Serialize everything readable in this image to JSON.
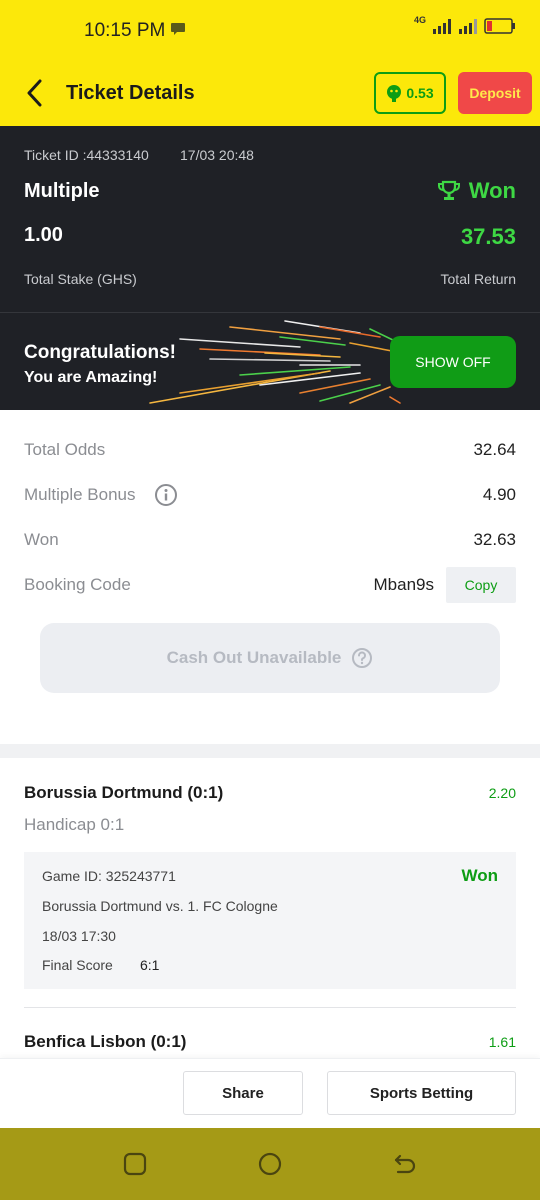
{
  "status_bar": {
    "time": "10:15 PM",
    "network": "4G"
  },
  "header": {
    "title": "Ticket Details",
    "balance": "0.53",
    "deposit_label": "Deposit"
  },
  "summary": {
    "ticket_id": "Ticket ID :44333140",
    "date": "17/03 20:48",
    "bet_type": "Multiple",
    "status": "Won",
    "total_stake": "1.00",
    "total_stake_label": "Total Stake (GHS)",
    "total_return": "37.53",
    "total_return_label": "Total Return"
  },
  "congrats": {
    "line1": "Congratulations!",
    "line2": "You are Amazing!",
    "button": "SHOW OFF"
  },
  "details": {
    "total_odds_label": "Total Odds",
    "total_odds": "32.64",
    "bonus_label": "Multiple Bonus",
    "bonus": "4.90",
    "won_label": "Won",
    "won": "32.63",
    "booking_label": "Booking Code",
    "booking_code": "Mban9s",
    "copy_label": "Copy",
    "cashout_label": "Cash Out Unavailable"
  },
  "selections": [
    {
      "team": "Borussia Dortmund (0:1)",
      "odds": "2.20",
      "market": "Handicap 0:1",
      "game_id": "Game ID: 325243771",
      "status": "Won",
      "match": "Borussia Dortmund vs. 1. FC Cologne",
      "datetime": "18/03 17:30",
      "score_label": "Final Score",
      "score": "6:1"
    },
    {
      "team": "Benfica Lisbon (0:1)",
      "odds": "1.61"
    }
  ],
  "actions": {
    "share": "Share",
    "sports_betting": "Sports Betting"
  },
  "colors": {
    "brand_yellow": "#fce80a",
    "win_green": "#3ed844",
    "deposit_red": "#f04848",
    "dark_bg": "#1f2126"
  }
}
